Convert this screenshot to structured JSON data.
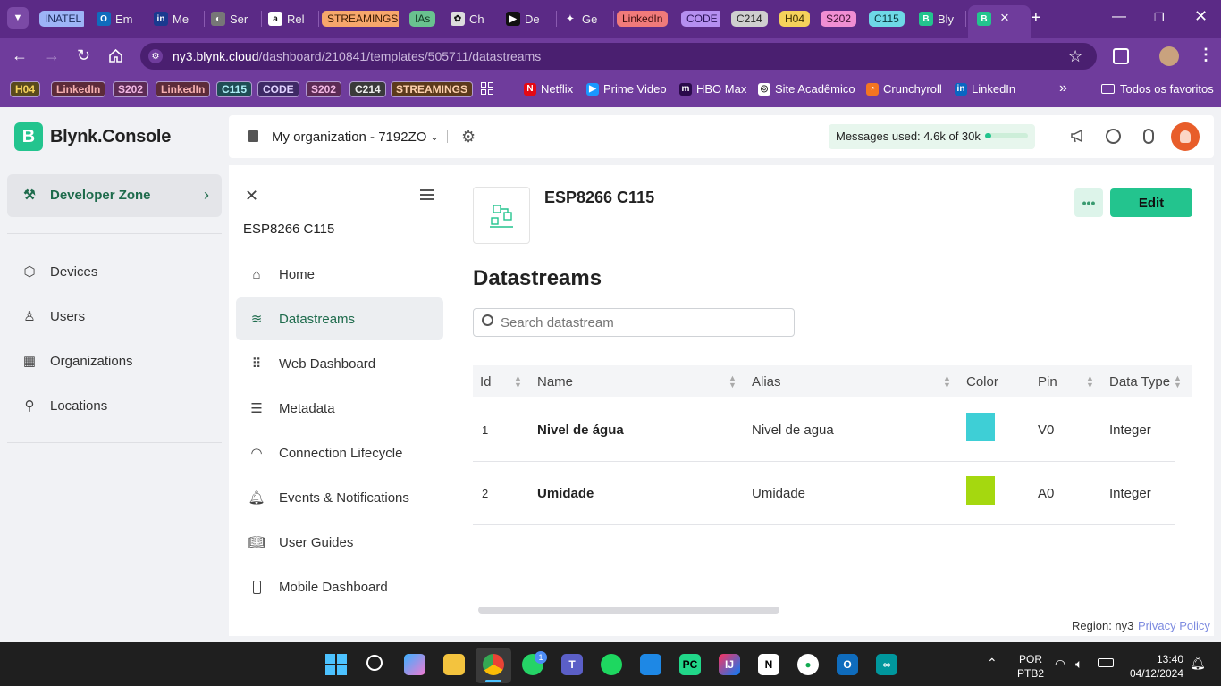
{
  "browser": {
    "tabs": [
      {
        "label": "INATEL",
        "kind": "chip",
        "bg": "#9db4f7",
        "fg": "#1b2a5a"
      },
      {
        "label": "Em",
        "icon": "outlook-icon"
      },
      {
        "label": "Me",
        "icon": "inatel-icon"
      },
      {
        "label": "Ser",
        "icon": "globe-icon"
      },
      {
        "label": "Rel",
        "icon": "amazon-icon"
      },
      {
        "label": "STREAMINGS",
        "kind": "chip",
        "bg": "#f7a76b",
        "fg": "#3a1a00"
      },
      {
        "label": "IAs",
        "kind": "chip",
        "bg": "#69c28f",
        "fg": "#113a22"
      },
      {
        "label": "Ch",
        "icon": "chatgpt-icon"
      },
      {
        "label": "De",
        "icon": "play-icon"
      },
      {
        "label": "Ge",
        "icon": "gemini-icon"
      },
      {
        "label": "LinkedIn",
        "kind": "chip",
        "bg": "#f17a7a",
        "fg": "#3a0b0b"
      },
      {
        "label": "CODE",
        "kind": "chip",
        "bg": "#b58ff0",
        "fg": "#2a1258"
      },
      {
        "label": "C214",
        "kind": "chip",
        "bg": "#cfcfcf",
        "fg": "#222"
      },
      {
        "label": "H04",
        "kind": "chip",
        "bg": "#f6d25b",
        "fg": "#3a2d00"
      },
      {
        "label": "S202",
        "kind": "chip",
        "bg": "#f08ed3",
        "fg": "#3c0d30"
      },
      {
        "label": "C115",
        "kind": "chip",
        "bg": "#6ed8e6",
        "fg": "#08343a"
      },
      {
        "label": "Bly",
        "icon": "blynk-icon"
      }
    ],
    "active_tab_close": "×",
    "new_tab": "+",
    "url_host": "ny3.blynk.cloud",
    "url_path": "/dashboard/210841/templates/505711/datastreams",
    "bookmarks": [
      {
        "label": "H04",
        "bg": "#5a4a1c",
        "fg": "#f6d25b"
      },
      {
        "label": "LinkedIn",
        "bg": "#5c2b3a",
        "fg": "#f6b0b0"
      },
      {
        "label": "S202",
        "bg": "#5c2b55",
        "fg": "#f3b8e4"
      },
      {
        "label": "LinkedIn",
        "bg": "#5c2b3a",
        "fg": "#f6b0b0"
      },
      {
        "label": "C115",
        "bg": "#1f4d55",
        "fg": "#aeeff7"
      },
      {
        "label": "CODE",
        "bg": "#3e2a66",
        "fg": "#e1d2ff"
      },
      {
        "label": "S202",
        "bg": "#5c2b55",
        "fg": "#f3b8e4"
      },
      {
        "label": "C214",
        "bg": "#3a3a3a",
        "fg": "#eeeeee"
      },
      {
        "label": "STREAMINGS",
        "bg": "#5c3a1c",
        "fg": "#ffd2ae"
      }
    ],
    "bookmark_links": [
      "Netflix",
      "Prime Video",
      "HBO Max",
      "Site Acadêmico",
      "Crunchyroll",
      "LinkedIn"
    ],
    "all_bookmarks": "Todos os favoritos"
  },
  "app": {
    "logo_letter": "B",
    "brand": "Blynk.Console",
    "org": "My organization - 7192ZO",
    "messages_label": "Messages used: 4.6k of 30k",
    "messages_used_fraction": 0.153,
    "sidebar": {
      "developer_zone": "Developer Zone",
      "items": [
        "Devices",
        "Users",
        "Organizations",
        "Locations"
      ]
    },
    "template": {
      "name": "ESP8266 C115",
      "menu": [
        "Home",
        "Datastreams",
        "Web Dashboard",
        "Metadata",
        "Connection Lifecycle",
        "Events & Notifications",
        "User Guides",
        "Mobile Dashboard"
      ],
      "active": "Datastreams"
    },
    "header_title": "ESP8266 C115",
    "more_label": "•••",
    "edit_label": "Edit",
    "page_title": "Datastreams",
    "search_placeholder": "Search datastream",
    "columns": [
      "Id",
      "Name",
      "Alias",
      "Color",
      "Pin",
      "Data Type"
    ],
    "rows": [
      {
        "id": "1",
        "name": "Nivel de água",
        "alias": "Nivel de agua",
        "color": "#3ecfd6",
        "pin": "V0",
        "type": "Integer"
      },
      {
        "id": "2",
        "name": "Umidade",
        "alias": "Umidade",
        "color": "#a5d80f",
        "pin": "A0",
        "type": "Integer"
      }
    ],
    "region_label": "Region: ny3",
    "privacy_label": "Privacy Policy"
  },
  "taskbar": {
    "lang_top": "POR",
    "lang_bottom": "PTB2",
    "time": "13:40",
    "date": "04/12/2024",
    "whatsapp_badge": "1"
  }
}
